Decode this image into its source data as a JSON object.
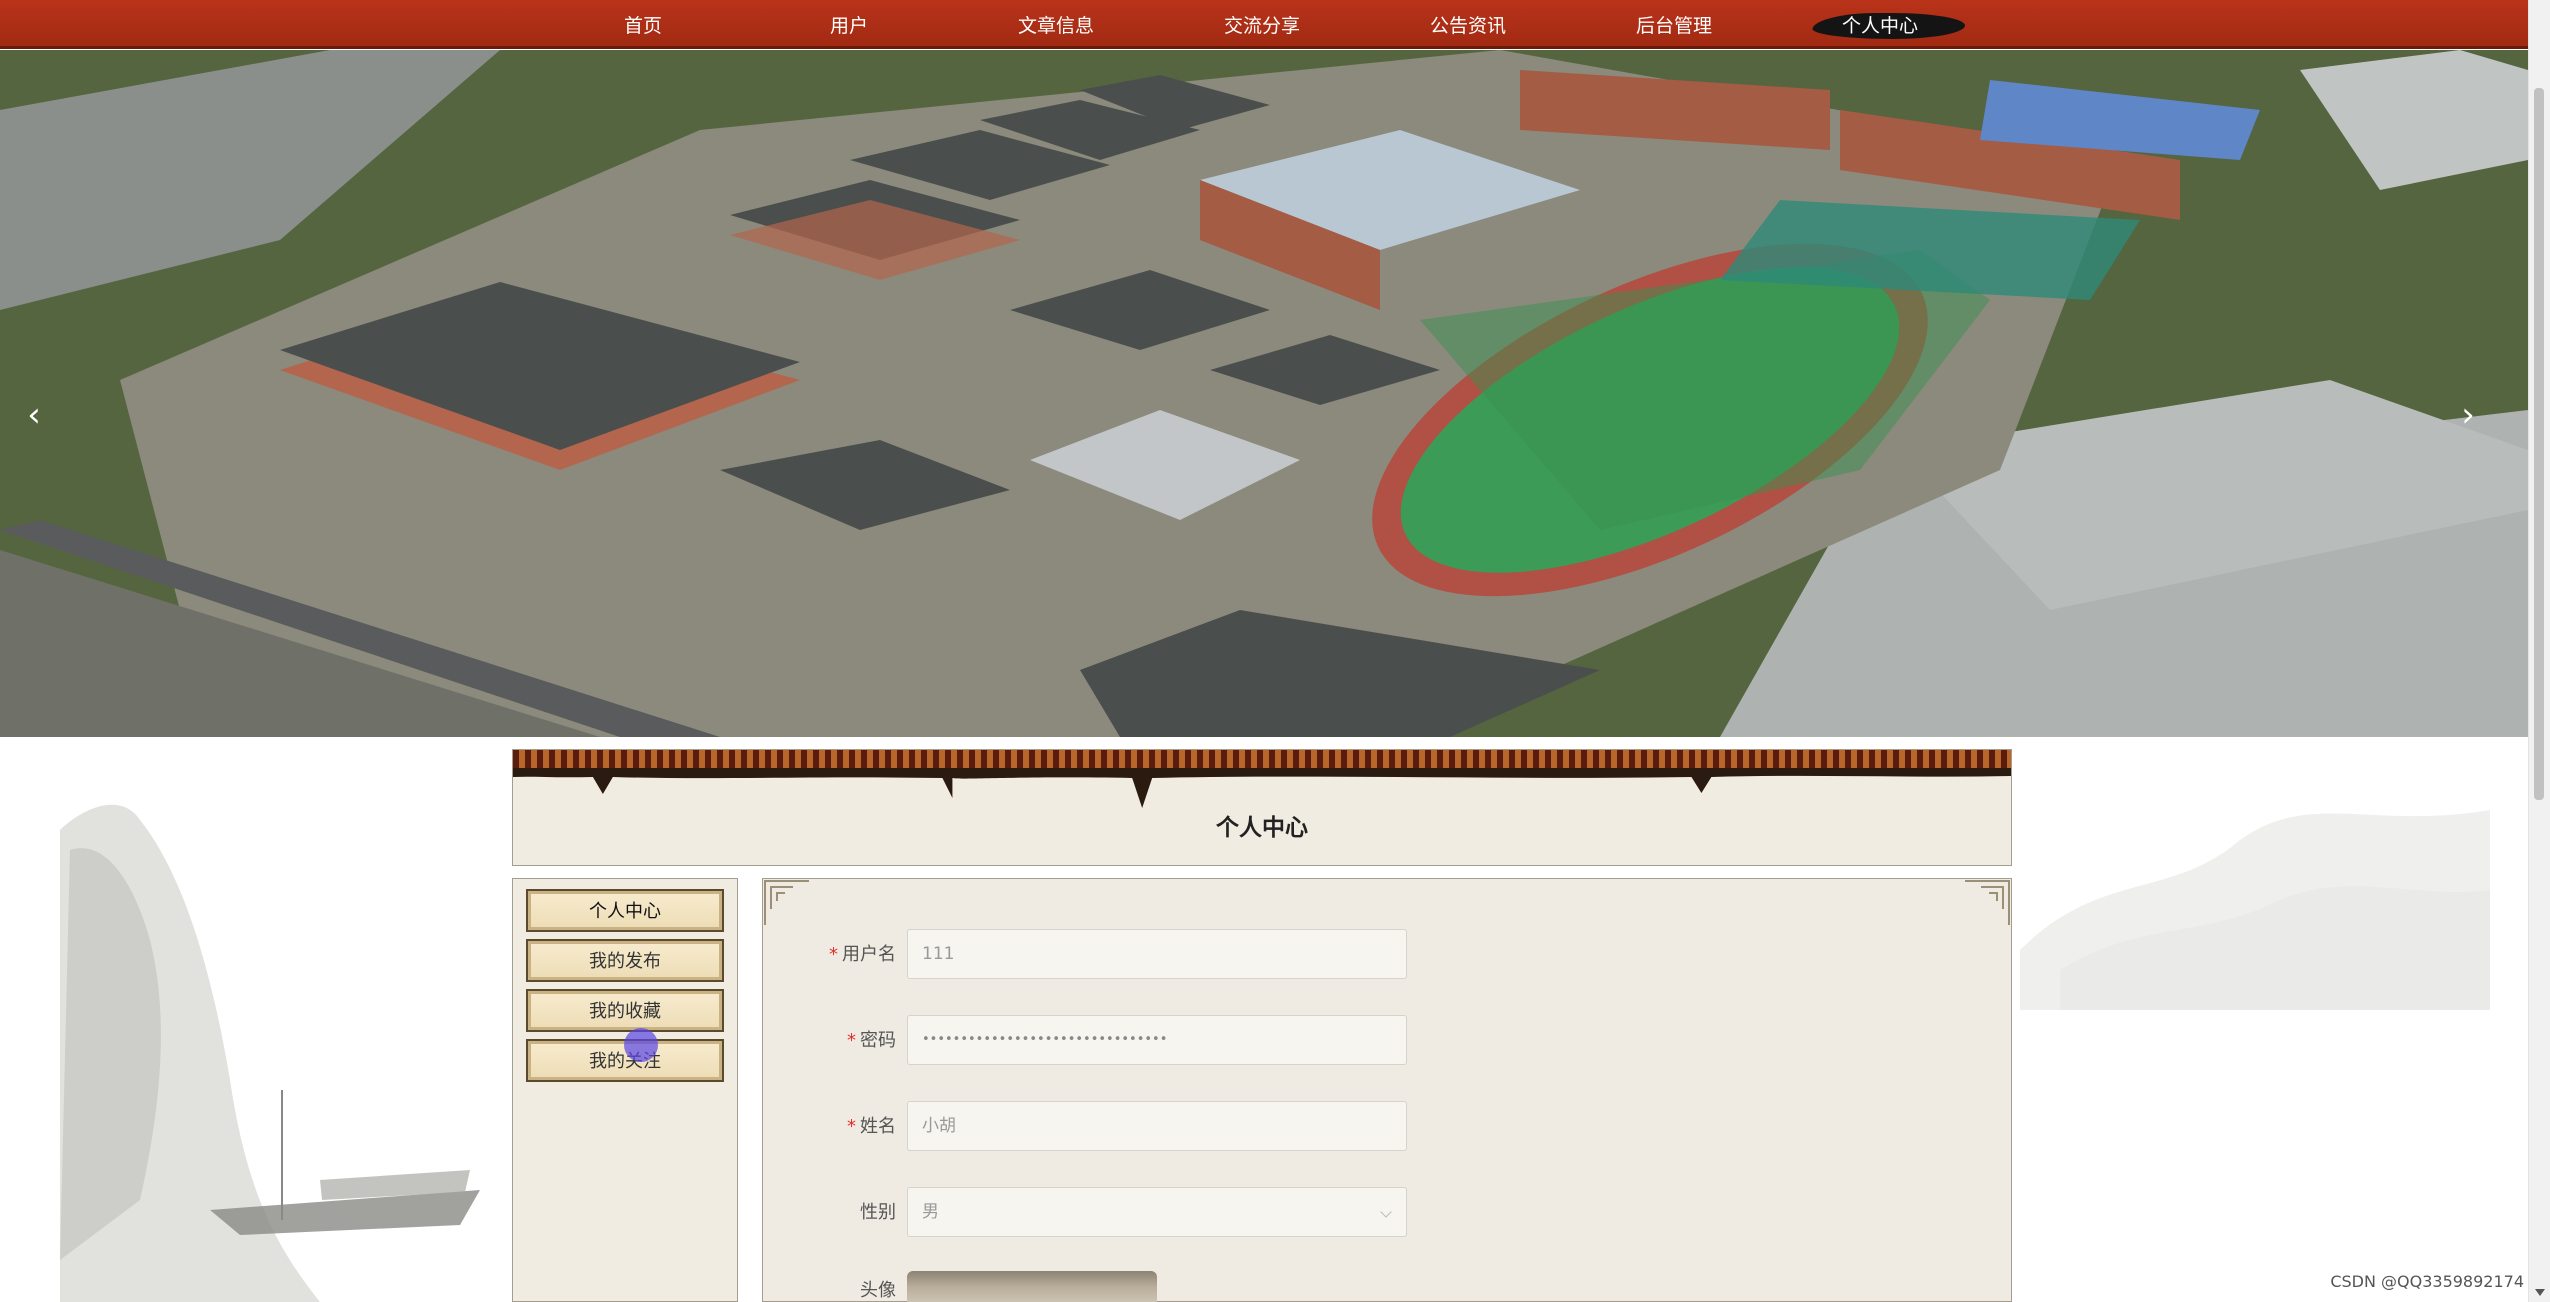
{
  "nav": {
    "items": [
      {
        "label": "首页"
      },
      {
        "label": "用户"
      },
      {
        "label": "文章信息"
      },
      {
        "label": "交流分享"
      },
      {
        "label": "公告资讯"
      },
      {
        "label": "后台管理"
      },
      {
        "label": "个人中心"
      }
    ],
    "active_index": 6
  },
  "banner": {
    "prev_label": "‹",
    "next_label": "›",
    "dot_count": 3,
    "active_dot": 2
  },
  "page": {
    "title": "个人中心"
  },
  "side_menu": {
    "items": [
      {
        "label": "个人中心"
      },
      {
        "label": "我的发布"
      },
      {
        "label": "我的收藏"
      },
      {
        "label": "我的关注"
      }
    ]
  },
  "form": {
    "username": {
      "label": "用户名",
      "required": "*",
      "value": "111"
    },
    "password": {
      "label": "密码",
      "required": "*",
      "value": "••••••••••••••••••••••••••••••••"
    },
    "name": {
      "label": "姓名",
      "required": "*",
      "value": "小胡"
    },
    "gender": {
      "label": "性别",
      "value": "男"
    },
    "avatar": {
      "label": "头像"
    }
  },
  "watermark": "CSDN @QQ3359892174",
  "colors": {
    "nav_bg": "#a22a12",
    "panel_bg": "#f1ece1",
    "required": "#e0312b"
  }
}
